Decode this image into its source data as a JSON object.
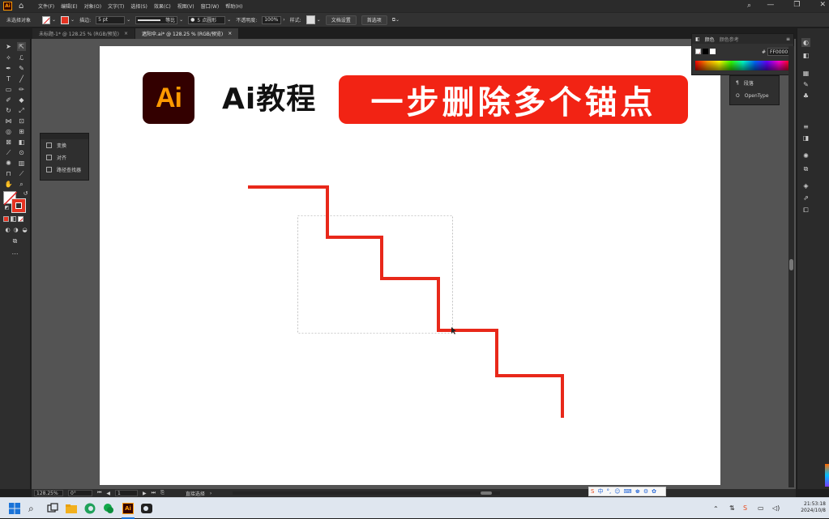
{
  "app": {
    "logo": "Ai",
    "menu": [
      "文件(F)",
      "编辑(E)",
      "对象(O)",
      "文字(T)",
      "选择(S)",
      "效果(C)",
      "视图(V)",
      "窗口(W)",
      "帮助(H)"
    ]
  },
  "control_bar": {
    "selection_label": "未选择对象",
    "stroke_label": "描边:",
    "stroke_value": "5 pt",
    "stroke_style": "等比",
    "brush": "5 点圆形",
    "opacity_label": "不透明度:",
    "opacity_value": "100%",
    "style_label": "样式:",
    "doc_setup": "文档设置",
    "preferences": "首选项"
  },
  "tabs": [
    {
      "label": "未标题-1* @ 128.25 % (RGB/预览)",
      "close": "×"
    },
    {
      "label": "遮阳伞.ai* @ 128.25 % (RGB/预览)",
      "close": "×"
    }
  ],
  "float_panel": {
    "items": [
      "变换",
      "对齐",
      "路径查找器"
    ]
  },
  "color_panel": {
    "tab1": "颜色",
    "tab2": "颜色参考",
    "hex": "FF0000"
  },
  "para_panel": {
    "items": [
      "段落",
      "OpenType"
    ]
  },
  "status_bar": {
    "zoom": "128.25%",
    "rotation": "0°",
    "artboard": "1",
    "tool": "直接选择"
  },
  "artwork": {
    "logo_text": "Ai",
    "title": "Ai教程",
    "banner": "一步删除多个锚点",
    "stroke_color": "#e8281a",
    "banner_color": "#f22314"
  },
  "ime": {
    "mode": "中"
  },
  "clock": {
    "time": "21:53:18",
    "date": "2024/10/8"
  }
}
